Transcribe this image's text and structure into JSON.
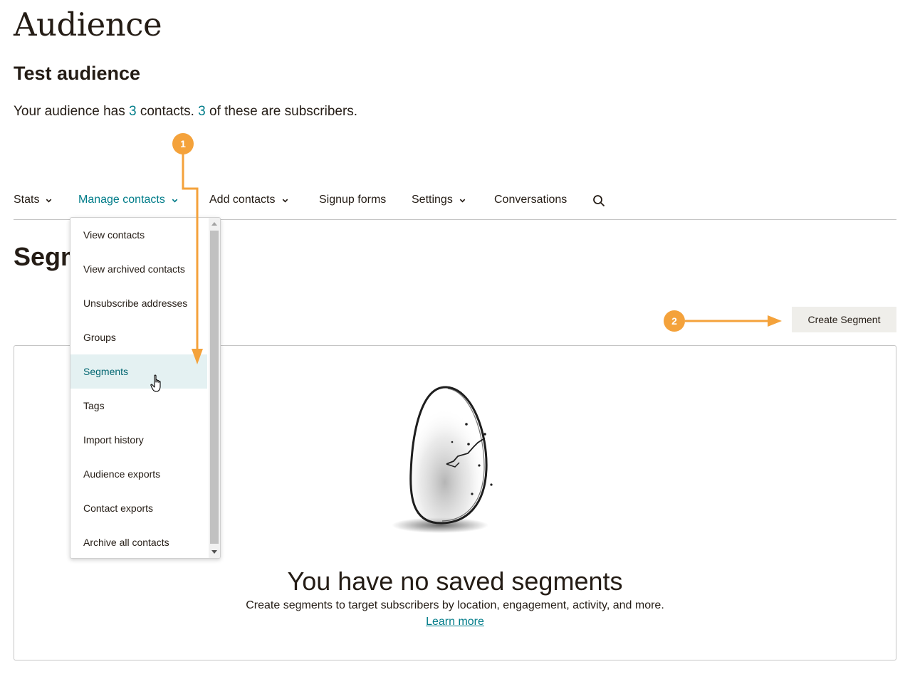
{
  "page": {
    "heading": "Audience",
    "audience_name": "Test audience"
  },
  "summary": {
    "prefix": "Your audience has ",
    "contacts_count": "3",
    "middle": " contacts. ",
    "subscribers_count": "3",
    "suffix": " of these are subscribers."
  },
  "nav": {
    "items": [
      {
        "label": "Stats"
      },
      {
        "label": "Manage contacts"
      },
      {
        "label": "Add contacts"
      },
      {
        "label": "Signup forms"
      },
      {
        "label": "Settings"
      },
      {
        "label": "Conversations"
      }
    ],
    "search_icon": "search-icon"
  },
  "dropdown": {
    "items": [
      {
        "label": "View contacts"
      },
      {
        "label": "View archived contacts"
      },
      {
        "label": "Unsubscribe addresses"
      },
      {
        "label": "Groups"
      },
      {
        "label": "Segments"
      },
      {
        "label": "Tags"
      },
      {
        "label": "Import history"
      },
      {
        "label": "Audience exports"
      },
      {
        "label": "Contact exports"
      },
      {
        "label": "Archive all contacts"
      }
    ],
    "selected": "Segments"
  },
  "section": {
    "heading": "Segm"
  },
  "actions": {
    "create_segment": "Create Segment"
  },
  "empty_state": {
    "title": "You have no saved segments",
    "description": "Create segments to target subscribers by location, engagement, activity, and more.",
    "link": "Learn more",
    "illustration": "cracked-egg-illustration"
  },
  "annotations": {
    "step1": "1",
    "step2": "2"
  },
  "colors": {
    "accent": "#007c89",
    "callout": "#f4a23b",
    "button_bg": "#efeeea",
    "selected_bg": "#e4f1f2"
  }
}
